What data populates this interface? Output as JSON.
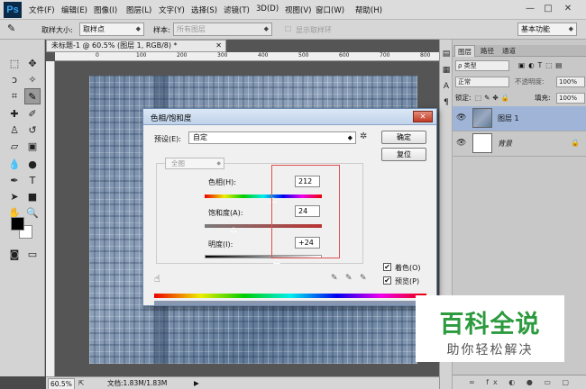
{
  "app": {
    "logo": "Ps"
  },
  "menu": [
    "文件(F)",
    "编辑(E)",
    "图像(I)",
    "图层(L)",
    "文字(Y)",
    "选择(S)",
    "滤镜(T)",
    "3D(D)",
    "视图(V)",
    "窗口(W)",
    "帮助(H)"
  ],
  "window_controls": [
    "—",
    "□",
    "✕"
  ],
  "options_bar": {
    "sample_size_label": "取样大小:",
    "sample_size_value": "取样点",
    "sample_label": "样本:",
    "sample_value": "所有图层",
    "show_ring_label": "显示取样环",
    "workspace": "基本功能"
  },
  "document": {
    "tab_title": "未标题-1 @ 60.5% (图层 1, RGB/8) *",
    "ruler_top": [
      "0",
      "100",
      "200",
      "300",
      "400",
      "500",
      "600",
      "700",
      "800"
    ],
    "zoom": "60.5%",
    "doc_info": "文档:1.83M/1.83M"
  },
  "panel": {
    "tabs": [
      "图层",
      "路径",
      "通道"
    ],
    "filter_label": "ρ 类型",
    "blend_mode": "正常",
    "opacity_label": "不透明度:",
    "opacity_value": "100%",
    "lock_label": "锁定:",
    "fill_label": "填充:",
    "fill_value": "100%",
    "layers": [
      {
        "name": "图层 1",
        "selected": true
      },
      {
        "name": "背景",
        "locked": true
      }
    ],
    "bottom_icons": "∞ fx ◐ ● ▭ ▢ 🗑"
  },
  "dialog": {
    "title": "色相/饱和度",
    "close": "✕",
    "preset_label": "预设(E):",
    "preset_value": "自定",
    "ok": "确定",
    "reset": "复位",
    "channel": "全图",
    "hue_label": "色相(H):",
    "hue_value": "212",
    "saturation_label": "饱和度(A):",
    "saturation_value": "24",
    "lightness_label": "明度(I):",
    "lightness_value": "+24",
    "colorize_label": "着色(O)",
    "colorize_checked": true,
    "preview_label": "预览(P)",
    "preview_checked": true
  },
  "watermark": {
    "main": "百科全说",
    "sub": "助你轻松解决"
  }
}
